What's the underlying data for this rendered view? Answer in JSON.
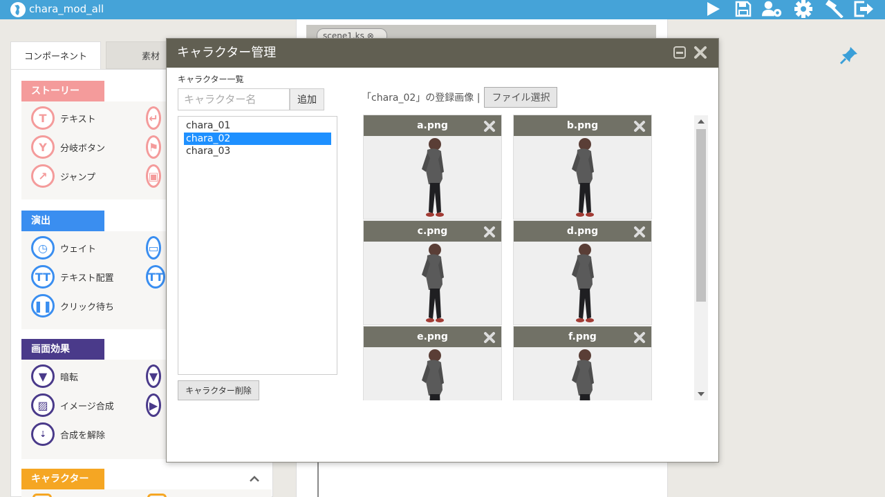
{
  "app": {
    "title": "chara_mod_all"
  },
  "colors": {
    "topbar": "#45a3d8",
    "story": "#f49b9b",
    "effect": "#3a8ef0",
    "screen_effect": "#4a3a8a",
    "character": "#f5a623",
    "dialog_header": "#615f52",
    "selection": "#1e90ff"
  },
  "toolbar_icons": [
    "play-icon",
    "save-icon",
    "user-settings-icon",
    "gear-icon",
    "hammer-icon",
    "exit-icon"
  ],
  "left_panel": {
    "tabs": [
      {
        "label": "コンポーネント",
        "active": true
      },
      {
        "label": "素材",
        "active": false
      }
    ],
    "groups": [
      {
        "label": "ストーリー",
        "items": [
          {
            "label": "テキスト",
            "icon": "text-icon"
          },
          {
            "label": "分岐ボタン",
            "icon": "branch-icon"
          },
          {
            "label": "ジャンプ",
            "icon": "jump-icon"
          }
        ]
      },
      {
        "label": "演出",
        "items": [
          {
            "label": "ウェイト",
            "icon": "clock-icon"
          },
          {
            "label": "テキスト配置",
            "icon": "text-layout-icon"
          },
          {
            "label": "クリック待ち",
            "icon": "pause-icon"
          }
        ]
      },
      {
        "label": "画面効果",
        "items": [
          {
            "label": "暗転",
            "icon": "fade-icon"
          },
          {
            "label": "イメージ合成",
            "icon": "image-compose-icon"
          },
          {
            "label": "合成を解除",
            "icon": "uncompose-icon"
          }
        ]
      },
      {
        "label": "キャラクター",
        "items": []
      }
    ]
  },
  "editor": {
    "scene_tab": "scene1.ks"
  },
  "dialog": {
    "title": "キャラクター管理",
    "list_label": "キャラクター一覧",
    "name_placeholder": "キャラクター名",
    "add_button": "追加",
    "characters": [
      "chara_01",
      "chara_02",
      "chara_03"
    ],
    "selected": "chara_02",
    "delete_button": "キャラクター削除",
    "images_caption": "「chara_02」の登録画像 |",
    "file_button": "ファイル選択",
    "images": [
      "a.png",
      "b.png",
      "c.png",
      "d.png",
      "e.png",
      "f.png"
    ]
  }
}
